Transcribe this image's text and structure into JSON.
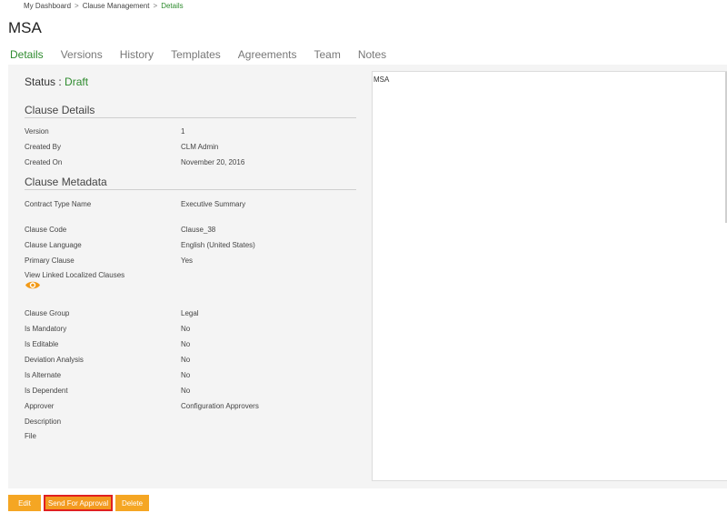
{
  "breadcrumb": {
    "items": [
      "My Dashboard",
      "Clause Management"
    ],
    "separator": ">",
    "current": "Details"
  },
  "title": "MSA",
  "tabs": [
    {
      "label": "Details",
      "active": true
    },
    {
      "label": "Versions"
    },
    {
      "label": "History"
    },
    {
      "label": "Templates"
    },
    {
      "label": "Agreements"
    },
    {
      "label": "Team"
    },
    {
      "label": "Notes"
    }
  ],
  "status": {
    "label": "Status :",
    "value": "Draft"
  },
  "clause_details": {
    "heading": "Clause Details",
    "rows": [
      {
        "label": "Version",
        "value": "1"
      },
      {
        "label": "Created By",
        "value": "CLM Admin"
      },
      {
        "label": "Created On",
        "value": "November 20, 2016"
      }
    ]
  },
  "clause_metadata": {
    "heading": "Clause Metadata",
    "contract_type": {
      "label": "Contract Type Name",
      "value": "Executive Summary"
    },
    "rows_a": [
      {
        "label": "Clause Code",
        "value": "Clause_38"
      },
      {
        "label": "Clause Language",
        "value": "English (United States)"
      },
      {
        "label": "Primary Clause",
        "value": "Yes"
      }
    ],
    "linked_label": "View Linked Localized Clauses",
    "rows_b": [
      {
        "label": "Clause Group",
        "value": "Legal"
      },
      {
        "label": "Is Mandatory",
        "value": "No"
      },
      {
        "label": "Is Editable",
        "value": "No"
      },
      {
        "label": "Deviation Analysis",
        "value": "No"
      },
      {
        "label": "Is Alternate",
        "value": "No"
      },
      {
        "label": "Is Dependent",
        "value": "No"
      },
      {
        "label": "Approver",
        "value": "Configuration Approvers"
      },
      {
        "label": "Description",
        "value": ""
      },
      {
        "label": "File",
        "value": ""
      }
    ]
  },
  "preview": {
    "text": "MSA"
  },
  "buttons": {
    "edit": "Edit",
    "send": "Send For Approval",
    "delete": "Delete"
  },
  "colors": {
    "accent_green": "#2e8b2e",
    "button_orange": "#f5a623",
    "highlight_red": "#e02020",
    "panel_bg": "#f4f4f4"
  },
  "icons": {
    "view_linked": "eye-icon"
  }
}
